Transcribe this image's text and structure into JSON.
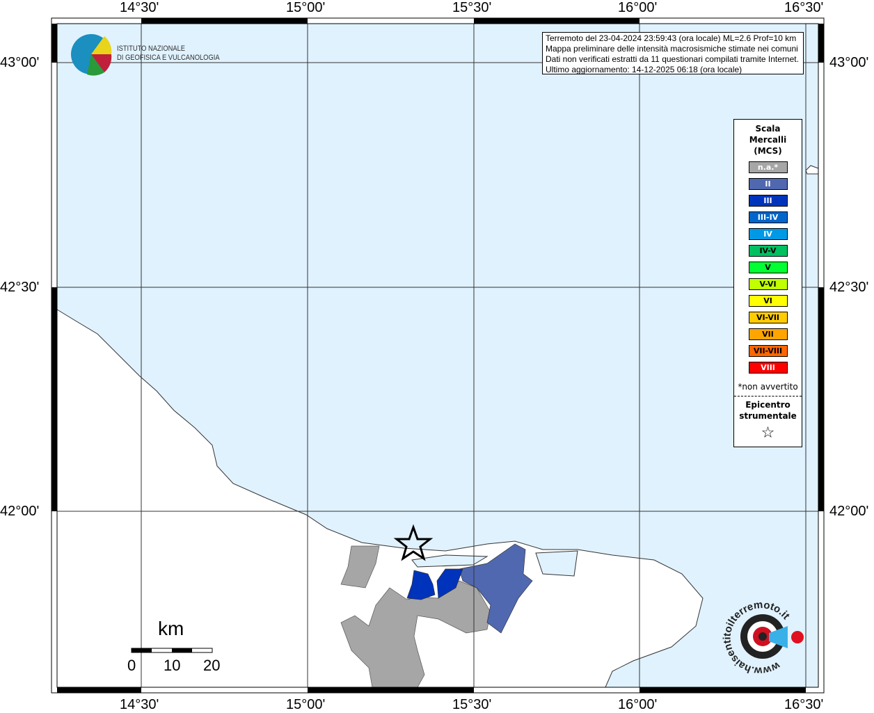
{
  "info": {
    "lines": [
      "Terremoto del 23-04-2024 23:59:43 (ora locale) ML=2.6 Prof=10 km",
      "Mappa preliminare delle intensità macrosismiche stimate nei comuni",
      "Dati non verificati estratti da 11 questionari compilati tramite Internet.",
      "Ultimo aggiornamento: 14-12-2025 06:18 (ora locale)"
    ]
  },
  "logo": {
    "line1": "ISTITUTO NAZIONALE",
    "line2": "DI GEOFISICA E VULCANOLOGIA"
  },
  "axes": {
    "lon": [
      "14°30'",
      "15°00'",
      "15°30'",
      "16°00'",
      "16°30'"
    ],
    "lat": [
      "43°00'",
      "42°30'",
      "42°00'"
    ]
  },
  "legend": {
    "title": [
      "Scala",
      "Mercalli",
      "(MCS)"
    ],
    "items": [
      {
        "label": "n.a.*",
        "color": "#a6a6a6",
        "text": "#ffffff"
      },
      {
        "label": "II",
        "color": "#5068b0",
        "text": "#ffffff"
      },
      {
        "label": "III",
        "color": "#0033bb",
        "text": "#ffffff"
      },
      {
        "label": "III-IV",
        "color": "#0066cc",
        "text": "#ffffff"
      },
      {
        "label": "IV",
        "color": "#0099e6",
        "text": "#ffffff"
      },
      {
        "label": "IV-V",
        "color": "#00c060",
        "text": "#000000"
      },
      {
        "label": "V",
        "color": "#00ff33",
        "text": "#000000"
      },
      {
        "label": "V-VI",
        "color": "#bfff00",
        "text": "#000000"
      },
      {
        "label": "VI",
        "color": "#ffff00",
        "text": "#000000"
      },
      {
        "label": "VI-VII",
        "color": "#ffcc00",
        "text": "#000000"
      },
      {
        "label": "VII",
        "color": "#ffa500",
        "text": "#000000"
      },
      {
        "label": "VII-VIII",
        "color": "#ff6600",
        "text": "#000000"
      },
      {
        "label": "VIII",
        "color": "#ff0000",
        "text": "#ffffff"
      }
    ],
    "note": "*non avvertito",
    "epi": [
      "Epicentro",
      "strumentale"
    ],
    "star": "☆"
  },
  "scale": {
    "unit": "km",
    "labels": [
      "0",
      "10",
      "20"
    ]
  },
  "colors": {
    "sea": "#e0f2fe",
    "land": "#ffffff"
  },
  "badge": "www.haisentitoilterremoto.it"
}
